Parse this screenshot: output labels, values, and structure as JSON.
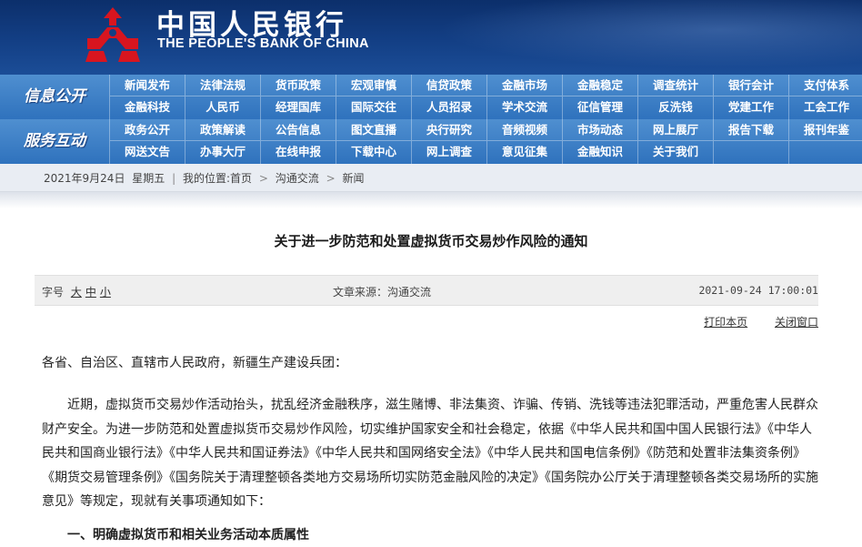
{
  "header": {
    "bank_name_cn": "中国人民银行",
    "bank_name_en": "THE PEOPLE'S BANK OF CHINA",
    "logo_icon": "pboc-emblem-icon",
    "colors": {
      "banner": "#133f85",
      "nav": "#2f72bd",
      "logo_red": "#d8151f"
    }
  },
  "nav": {
    "row1": {
      "title": "信息公开",
      "items": [
        "新闻发布",
        "法律法规",
        "货币政策",
        "宏观审慎",
        "信贷政策",
        "金融市场",
        "金融稳定",
        "调查统计",
        "银行会计",
        "支付体系",
        "金融科技",
        "人民币",
        "经理国库",
        "国际交往",
        "人员招录",
        "学术交流",
        "征信管理",
        "反洗钱",
        "党建工作",
        "工会工作"
      ]
    },
    "row2": {
      "title": "服务互动",
      "items": [
        "政务公开",
        "政策解读",
        "公告信息",
        "图文直播",
        "央行研究",
        "音频视频",
        "市场动态",
        "网上展厅",
        "报告下载",
        "报刊年鉴",
        "网送文告",
        "办事大厅",
        "在线申报",
        "下载中心",
        "网上调查",
        "意见征集",
        "金融知识",
        "关于我们",
        "",
        ""
      ]
    }
  },
  "breadcrumb": {
    "date": "2021年9月24日",
    "weekday": "星期五",
    "location_label": "我的位置:",
    "items": [
      "首页",
      "沟通交流",
      "新闻"
    ]
  },
  "article": {
    "title": "关于进一步防范和处置虚拟货币交易炒作风险的通知",
    "font_size_label": "字号",
    "font_sizes": [
      "大",
      "中",
      "小"
    ],
    "source": "文章来源：沟通交流",
    "datetime": "2021-09-24 17:00:01",
    "print_label": "打印本页",
    "close_label": "关闭窗口",
    "addressee": "各省、自治区、直辖市人民政府，新疆生产建设兵团：",
    "paragraph1": "近期，虚拟货币交易炒作活动抬头，扰乱经济金融秩序，滋生赌博、非法集资、诈骗、传销、洗钱等违法犯罪活动，严重危害人民群众财产安全。为进一步防范和处置虚拟货币交易炒作风险，切实维护国家安全和社会稳定，依据《中华人民共和国中国人民银行法》《中华人民共和国商业银行法》《中华人民共和国证券法》《中华人民共和国网络安全法》《中华人民共和国电信条例》《防范和处置非法集资条例》《期货交易管理条例》《国务院关于清理整顿各类地方交易场所切实防范金融风险的决定》《国务院办公厅关于清理整顿各类交易场所的实施意见》等规定，现就有关事项通知如下：",
    "heading1": "一、明确虚拟货币和相关业务活动本质属性"
  }
}
